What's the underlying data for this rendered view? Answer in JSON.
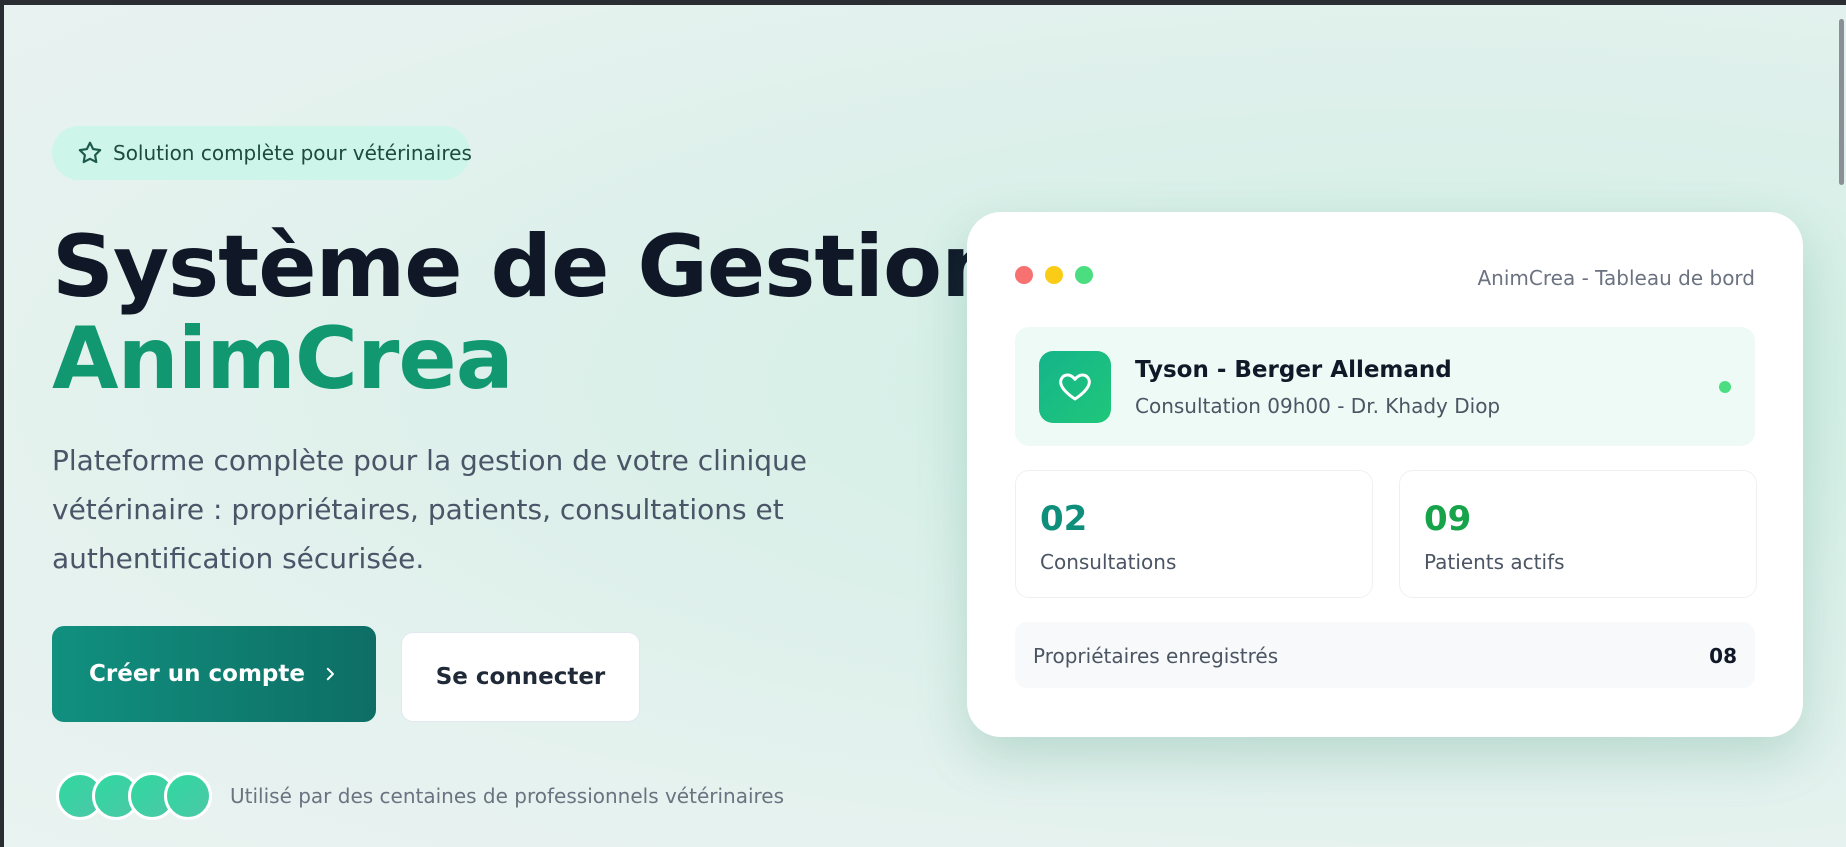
{
  "hero": {
    "badge": {
      "icon": "star-icon",
      "text": "Solution complète pour vétérinaires"
    },
    "title_line1": "Système de Gestion",
    "title_line2": "AnimCrea",
    "description": "Plateforme complète pour la gestion de votre clinique vétérinaire : propriétaires, patients, consultations et authentification sécurisée.",
    "primary_button": "Créer un compte",
    "secondary_button": "Se connecter",
    "social_proof": "Utilisé par des centaines de professionnels vétérinaires",
    "avatar_count": 4
  },
  "dashboard": {
    "window_title": "AnimCrea - Tableau de bord",
    "window_dots": [
      "#f87171",
      "#facc15",
      "#4ade80"
    ],
    "patient": {
      "icon": "heart-icon",
      "name": "Tyson - Berger Allemand",
      "details": "Consultation 09h00 - Dr. Khady Diop",
      "status_color": "#4ade80"
    },
    "stats": [
      {
        "value": "02",
        "label": "Consultations",
        "color": "#0d8f7c"
      },
      {
        "value": "09",
        "label": "Patients actifs",
        "color": "#16a34a"
      }
    ],
    "owners": {
      "label": "Propriétaires enregistrés",
      "value": "08"
    }
  },
  "colors": {
    "brand": "#129870",
    "primary_button": "#0e6e65",
    "heading": "#101828"
  }
}
